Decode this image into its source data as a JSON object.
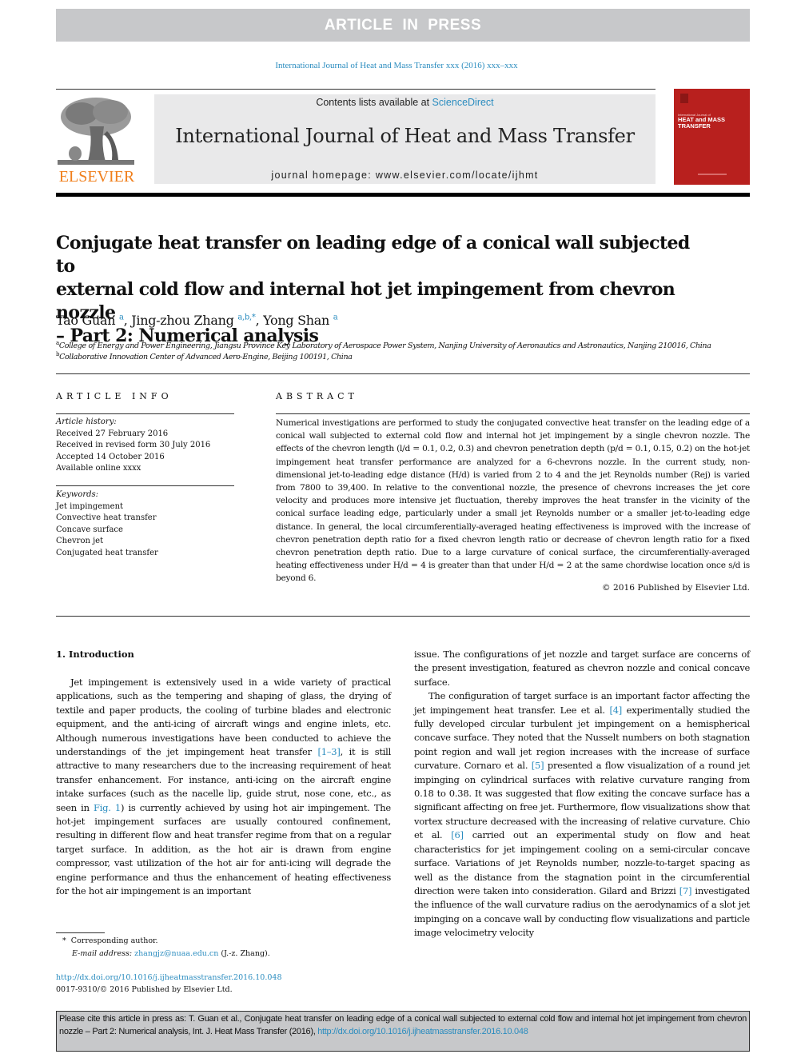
{
  "banner": {
    "text": "ARTICLE IN PRESS"
  },
  "journal_ref": "International Journal of Heat and Mass Transfer xxx (2016) xxx–xxx",
  "publisher_logo": {
    "wordmark": "ELSEVIER",
    "icon": "elsevier-tree-icon"
  },
  "masthead": {
    "contents_prefix": "Contents lists available at ",
    "contents_link": "ScienceDirect",
    "journal_title": "International Journal of Heat and Mass Transfer",
    "homepage_prefix": "journal homepage: ",
    "homepage_url": "www.elsevier.com/locate/ijhmt"
  },
  "cover": {
    "small_text": "International Journal of",
    "title_line1": "HEAT and MASS",
    "title_line2": "TRANSFER"
  },
  "article": {
    "title_lines": [
      "Conjugate heat transfer on leading edge of a conical wall subjected to",
      "external cold flow and internal hot jet impingement from chevron nozzle",
      "– Part 2: Numerical analysis"
    ],
    "authors": [
      {
        "name": "Tao Guan",
        "sup": "a",
        "sep": ", "
      },
      {
        "name": "Jing-zhou Zhang",
        "sup": "a,b,*",
        "sep": ", "
      },
      {
        "name": "Yong Shan",
        "sup": "a",
        "sep": ""
      }
    ],
    "affiliations": [
      {
        "sup": "a",
        "text": "College of Energy and Power Engineering, Jiangsu Province Key Laboratory of Aerospace Power System, Nanjing University of Aeronautics and Astronautics, Nanjing 210016, China"
      },
      {
        "sup": "b",
        "text": "Collaborative Innovation Center of Advanced Aero-Engine, Beijing 100191, China"
      }
    ]
  },
  "article_info": {
    "heading": "ARTICLE INFO",
    "history_label": "Article history:",
    "history": [
      "Received 27 February 2016",
      "Received in revised form 30 July 2016",
      "Accepted 14 October 2016",
      "Available online xxxx"
    ],
    "keywords_label": "Keywords:",
    "keywords": [
      "Jet impingement",
      "Convective heat transfer",
      "Concave surface",
      "Chevron jet",
      "Conjugated heat transfer"
    ]
  },
  "abstract": {
    "heading": "ABSTRACT",
    "text": "Numerical investigations are performed to study the conjugated convective heat transfer on the leading edge of a conical wall subjected to external cold flow and internal hot jet impingement by a single chevron nozzle. The effects of the chevron length (l/d = 0.1, 0.2, 0.3) and chevron penetration depth (p/d = 0.1, 0.15, 0.2) on the hot-jet impingement heat transfer performance are analyzed for a 6-chevrons nozzle. In the current study, non-dimensional jet-to-leading edge distance (H/d) is varied from 2 to 4 and the jet Reynolds number (Rej) is varied from 7800 to 39,400. In relative to the conventional nozzle, the presence of chevrons increases the jet core velocity and produces more intensive jet fluctuation, thereby improves the heat transfer in the vicinity of the conical surface leading edge, particularly under a small jet Reynolds number or a smaller jet-to-leading edge distance. In general, the local circumferentially-averaged heating effectiveness is improved with the increase of chevron penetration depth ratio for a fixed chevron length ratio or decrease of chevron length ratio for a fixed chevron penetration depth ratio. Due to a large curvature of conical surface, the circumferentially-averaged heating effectiveness under H/d = 4 is greater than that under H/d = 2 at the same chordwise location once s/d is beyond 6.",
    "copyright": "© 2016 Published by Elsevier Ltd."
  },
  "introduction": {
    "heading": "1. Introduction",
    "left_col": {
      "p1_a": "Jet impingement is extensively used in a wide variety of practical applications, such as the tempering and shaping of glass, the drying of textile and paper products, the cooling of turbine blades and electronic equipment, and the anti-icing of aircraft wings and engine inlets, etc. Although numerous investigations have been conducted to achieve the understandings of the jet impingement heat transfer ",
      "ref_1_3": "[1–3]",
      "p1_b": ", it is still attractive to many researchers due to the increasing requirement of heat transfer enhancement. For instance, anti-icing on the aircraft engine intake surfaces (such as the nacelle lip, guide strut, nose cone, etc., as seen in ",
      "fig_ref": "Fig. 1",
      "p1_c": ") is currently achieved by using hot air impingement. The hot-jet impingement surfaces are usually contoured confinement, resulting in different flow and heat transfer regime from that on a regular target surface. In addition, as the hot air is drawn from engine compressor, vast utilization of the hot air for anti-icing will degrade the engine performance and thus the enhancement of heating effectiveness for the hot air impingement is an important"
    },
    "right_col": {
      "p1_end": "issue. The configurations of jet nozzle and target surface are concerns of the present investigation, featured as chevron nozzle and conical concave surface.",
      "p2_a": "The configuration of target surface is an important factor affecting the jet impingement heat transfer. Lee et al. ",
      "ref_4": "[4]",
      "p2_b": " experimentally studied the fully developed circular turbulent jet impingement on a hemispherical concave surface. They noted that the Nusselt numbers on both stagnation point region and wall jet region increases with the increase of surface curvature. Cornaro et al. ",
      "ref_5": "[5]",
      "p2_c": " presented a flow visualization of a round jet impinging on cylindrical surfaces with relative curvature ranging from 0.18 to 0.38. It was suggested that flow exiting the concave surface has a significant affecting on free jet. Furthermore, flow visualizations show that vortex structure decreased with the increasing of relative curvature. Chio et al. ",
      "ref_6": "[6]",
      "p2_d": " carried out an experimental study on flow and heat characteristics for jet impingement cooling on a semi-circular concave surface. Variations of jet Reynolds number, nozzle-to-target spacing as well as the distance from the stagnation point in the circumferential direction were taken into consideration. Gilard and Brizzi ",
      "ref_7": "[7]",
      "p2_e": " investigated the influence of the wall curvature radius on the aerodynamics of a slot jet impinging on a concave wall by conducting flow visualizations and particle image velocimetry velocity"
    }
  },
  "footnotes": {
    "star": "*",
    "corresponding": "Corresponding author.",
    "email_label": "E-mail address:",
    "email": "zhangjz@nuaa.edu.cn",
    "email_suffix": " (J.-z. Zhang).",
    "doi": "http://dx.doi.org/10.1016/j.ijheatmasstransfer.2016.10.048",
    "issn": "0017-9310/© 2016 Published by Elsevier Ltd."
  },
  "cite_box": {
    "text": "Please cite this article in press as: T. Guan et al., Conjugate heat transfer on leading edge of a conical wall subjected to external cold flow and internal hot jet impingement from chevron nozzle – Part 2: Numerical analysis, Int. J. Heat Mass Transfer (2016), ",
    "link": "http://dx.doi.org/10.1016/j.ijheatmasstransfer.2016.10.048"
  }
}
